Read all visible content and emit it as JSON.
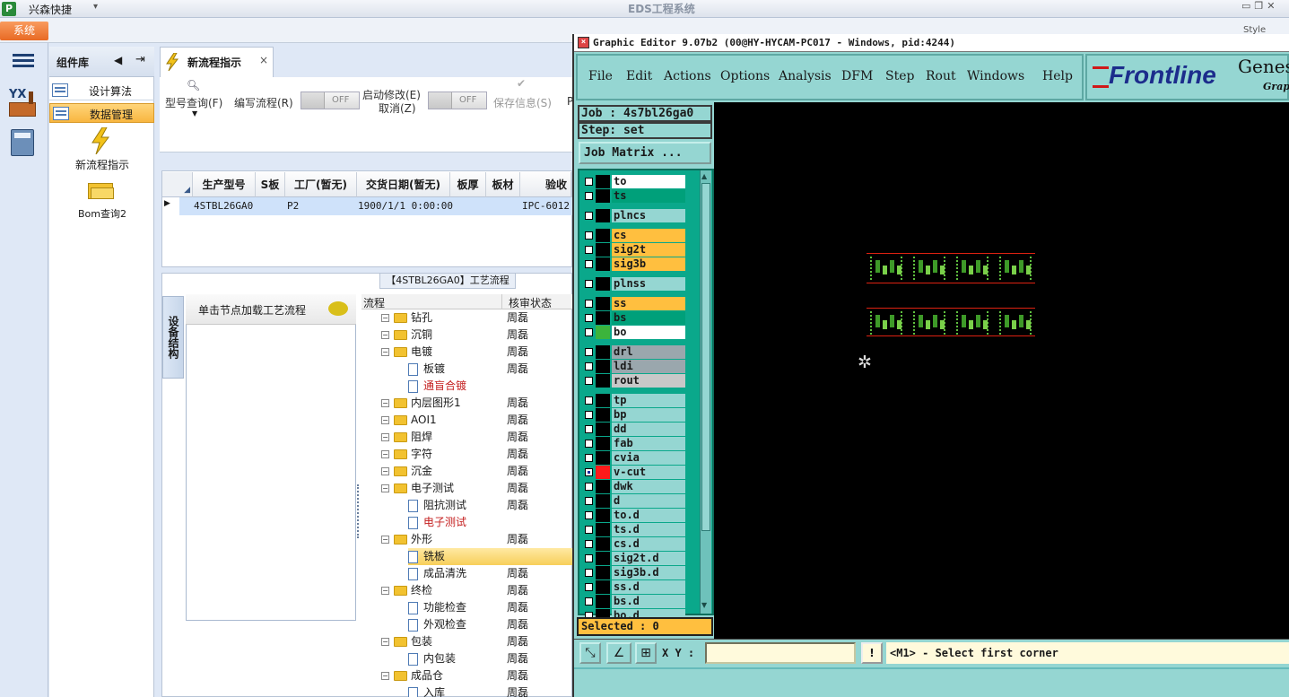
{
  "titlebar": {
    "app_name": "兴森快捷",
    "title": "EDS工程系统",
    "style_label": "Style"
  },
  "ribbon": {
    "system_tab": "系统"
  },
  "components": {
    "header": "组件库",
    "items": [
      {
        "label": "设计算法"
      },
      {
        "label": "数据管理"
      }
    ],
    "tiles": [
      {
        "label": "新流程指示"
      },
      {
        "label": "Bom查询2"
      }
    ]
  },
  "doc_tab": {
    "label": "新流程指示"
  },
  "toolbar": {
    "query": "型号查询(F)",
    "write": "编写流程(R)",
    "toggle1": "OFF",
    "restart": "启动修改(E)",
    "cancel": "取消(Z)",
    "toggle2": "OFF",
    "save": "保存信息(S)",
    "more": "P"
  },
  "grid": {
    "columns": [
      "生产型号",
      "S板",
      "工厂(暂无)",
      "交货日期(暂无)",
      "板厚",
      "板材",
      "验收"
    ],
    "row": {
      "model": "4STBL26GA0",
      "s": "",
      "factory": "P2",
      "date": "1900/1/1 0:00:00",
      "thick": "",
      "mat": "",
      "accept": "IPC-6012"
    }
  },
  "flow": {
    "title": "【4STBL26GA0】工艺流程",
    "side_tab": "设备结构",
    "hint": "单击节点加载工艺流程",
    "col_flow": "流程",
    "col_status": "核审状态",
    "rows": [
      {
        "label": "钻孔",
        "status": "周磊",
        "level": 0,
        "type": "folder"
      },
      {
        "label": "沉铜",
        "status": "周磊",
        "level": 0,
        "type": "folder"
      },
      {
        "label": "电镀",
        "status": "周磊",
        "level": 0,
        "type": "folder"
      },
      {
        "label": "板镀",
        "status": "周磊",
        "level": 1,
        "type": "doc"
      },
      {
        "label": "通盲合镀",
        "status": "",
        "level": 1,
        "type": "doc",
        "red": true
      },
      {
        "label": "内层图形1",
        "status": "周磊",
        "level": 0,
        "type": "folder"
      },
      {
        "label": "AOI1",
        "status": "周磊",
        "level": 0,
        "type": "folder"
      },
      {
        "label": "阻焊",
        "status": "周磊",
        "level": 0,
        "type": "folder"
      },
      {
        "label": "字符",
        "status": "周磊",
        "level": 0,
        "type": "folder"
      },
      {
        "label": "沉金",
        "status": "周磊",
        "level": 0,
        "type": "folder"
      },
      {
        "label": "电子测试",
        "status": "周磊",
        "level": 0,
        "type": "folder"
      },
      {
        "label": "阻抗测试",
        "status": "周磊",
        "level": 1,
        "type": "doc"
      },
      {
        "label": "电子测试",
        "status": "",
        "level": 1,
        "type": "doc",
        "red": true
      },
      {
        "label": "外形",
        "status": "周磊",
        "level": 0,
        "type": "folder"
      },
      {
        "label": "铣板",
        "status": "",
        "level": 1,
        "type": "doc",
        "selected": true
      },
      {
        "label": "成品清洗",
        "status": "周磊",
        "level": 1,
        "type": "doc"
      },
      {
        "label": "终检",
        "status": "周磊",
        "level": 0,
        "type": "folder"
      },
      {
        "label": "功能检查",
        "status": "周磊",
        "level": 1,
        "type": "doc"
      },
      {
        "label": "外观检查",
        "status": "周磊",
        "level": 1,
        "type": "doc"
      },
      {
        "label": "包装",
        "status": "周磊",
        "level": 0,
        "type": "folder"
      },
      {
        "label": "内包装",
        "status": "周磊",
        "level": 1,
        "type": "doc"
      },
      {
        "label": "成品仓",
        "status": "周磊",
        "level": 0,
        "type": "folder"
      },
      {
        "label": "入库",
        "status": "周磊",
        "level": 1,
        "type": "doc"
      }
    ]
  },
  "genesis": {
    "title": "Graphic Editor 9.07b2 (00@HY-HYCAM-PC017 - Windows, pid:4244)",
    "menu": [
      "File",
      "Edit",
      "Actions",
      "Options",
      "Analysis",
      "DFM",
      "Step",
      "Rout",
      "Windows",
      "Help"
    ],
    "brand": "Frontline",
    "brand2": "Genes",
    "brand3": "Graph",
    "job": "Job : 4s7bl26ga0",
    "step": "Step: set",
    "job_matrix": "Job Matrix ...",
    "layers": [
      {
        "name": "to",
        "color": "#ffffff",
        "group": 1
      },
      {
        "name": "ts",
        "color": "#00a07a",
        "group": 1
      },
      {
        "name": "plncs",
        "color": "#95d6d2",
        "group": 2
      },
      {
        "name": "cs",
        "color": "#ffbf3f",
        "group": 3
      },
      {
        "name": "sig2t",
        "color": "#ffbf3f",
        "group": 3
      },
      {
        "name": "sig3b",
        "color": "#ffbf3f",
        "group": 3
      },
      {
        "name": "plnss",
        "color": "#95d6d2",
        "group": 4
      },
      {
        "name": "ss",
        "color": "#ffbf3f",
        "group": 5
      },
      {
        "name": "bs",
        "color": "#00a07a",
        "group": 5
      },
      {
        "name": "bo",
        "color": "#ffffff",
        "group": 5,
        "swatch": "#3cb43c"
      },
      {
        "name": "drl",
        "color": "#9aa7ad",
        "group": 6
      },
      {
        "name": "ldi",
        "color": "#9aa7ad",
        "group": 6
      },
      {
        "name": "rout",
        "color": "#c8c8c8",
        "group": 6
      },
      {
        "name": "tp",
        "color": "#95d6d2",
        "group": 7
      },
      {
        "name": "bp",
        "color": "#95d6d2",
        "group": 7
      },
      {
        "name": "dd",
        "color": "#95d6d2",
        "group": 7
      },
      {
        "name": "fab",
        "color": "#95d6d2",
        "group": 7
      },
      {
        "name": "cvia",
        "color": "#95d6d2",
        "group": 7
      },
      {
        "name": "v-cut",
        "color": "#95d6d2",
        "group": 7,
        "swatch": "#ff1a1a",
        "active": true
      },
      {
        "name": "dwk",
        "color": "#95d6d2",
        "group": 7
      },
      {
        "name": "d",
        "color": "#95d6d2",
        "group": 7
      },
      {
        "name": "to.d",
        "color": "#95d6d2",
        "group": 7
      },
      {
        "name": "ts.d",
        "color": "#95d6d2",
        "group": 7
      },
      {
        "name": "cs.d",
        "color": "#95d6d2",
        "group": 7
      },
      {
        "name": "sig2t.d",
        "color": "#95d6d2",
        "group": 7
      },
      {
        "name": "sig3b.d",
        "color": "#95d6d2",
        "group": 7
      },
      {
        "name": "ss.d",
        "color": "#95d6d2",
        "group": 7
      },
      {
        "name": "bs.d",
        "color": "#95d6d2",
        "group": 7
      },
      {
        "name": "bo.d",
        "color": "#95d6d2",
        "group": 7
      }
    ],
    "selected": "Selected : 0",
    "xy_label": "X Y :",
    "xy_value": "",
    "prompt": "<M1> - Select first corner"
  }
}
